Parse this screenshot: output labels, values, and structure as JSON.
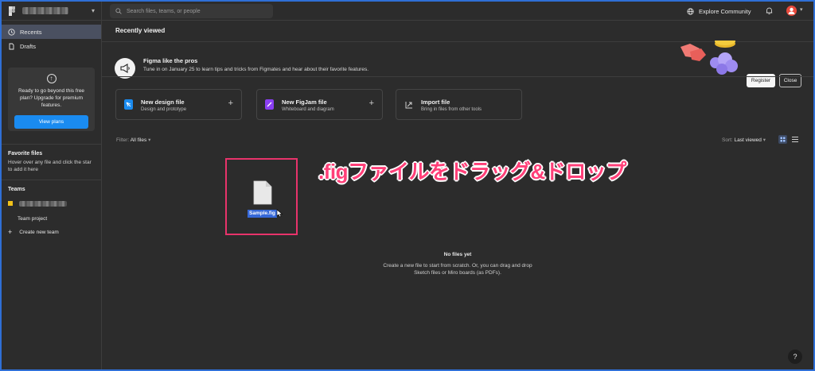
{
  "sidebar": {
    "nav": [
      {
        "label": "Recents",
        "icon": "clock-icon",
        "active": true
      },
      {
        "label": "Drafts",
        "icon": "file-icon",
        "active": false
      }
    ],
    "promo": {
      "text": "Ready to go beyond this free plan? Upgrade for premium features.",
      "button": "View plans"
    },
    "favorites": {
      "title": "Favorite files",
      "text": "Hover over any file and click the star to add it here"
    },
    "teams": {
      "title": "Teams",
      "project": "Team project",
      "create": "Create new team"
    }
  },
  "topbar": {
    "search_placeholder": "Search files, teams, or people",
    "explore": "Explore Community"
  },
  "main": {
    "recent_title": "Recently viewed",
    "banner": {
      "title": "Figma like the pros",
      "subtitle": "Tune in on January 25 to learn tips and tricks from Figmates and hear about their favorite features.",
      "register": "Register",
      "close": "Close"
    },
    "cards": [
      {
        "title": "New design file",
        "subtitle": "Design and prototype",
        "icon": "design-file-icon",
        "color": "#1a8bf0"
      },
      {
        "title": "New FigJam file",
        "subtitle": "Whiteboard and diagram",
        "icon": "figjam-file-icon",
        "color": "#8a3ff2"
      },
      {
        "title": "Import file",
        "subtitle": "Bring in files from other tools",
        "icon": "import-icon",
        "color": "#cfcfcf"
      }
    ],
    "filter": {
      "label": "Filter:",
      "value": "All files"
    },
    "sort": {
      "label": "Sort:",
      "value": "Last viewed"
    },
    "dragged_file": "Sample.fig",
    "annotation": ".figファイルをドラッグ&ドロップ",
    "empty": {
      "title": "No files yet",
      "text": "Create a new file to start from scratch. Or, you can drag and drop Sketch files or Miro boards (as PDFs)."
    },
    "help": "?"
  },
  "colors": {
    "accent": "#1a8bf0",
    "annotation": "#ff3f78",
    "highlight_border": "#e8336b"
  }
}
